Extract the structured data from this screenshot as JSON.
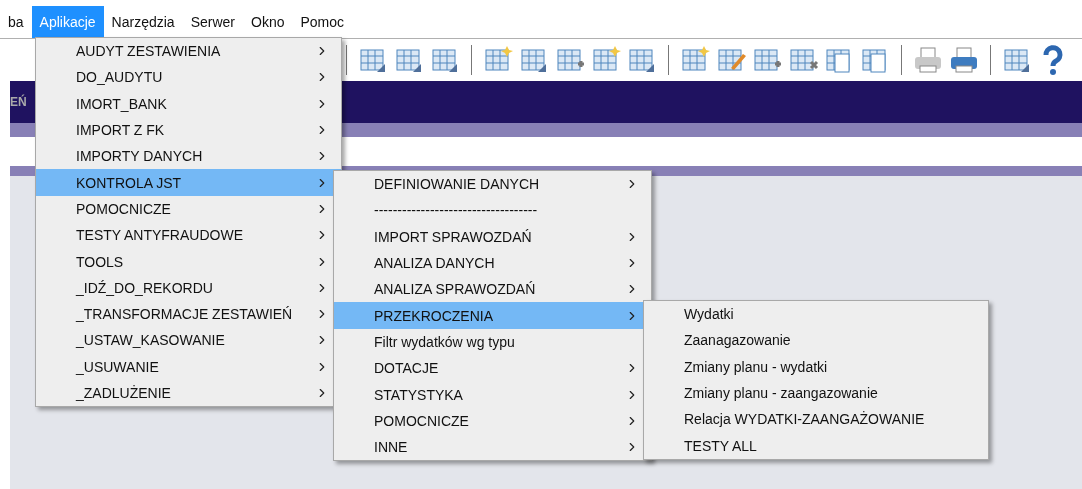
{
  "menubar": [
    {
      "label": "ba",
      "selected": false
    },
    {
      "label": "Aplikacje",
      "selected": true
    },
    {
      "label": "Narzędzia",
      "selected": false
    },
    {
      "label": "Serwer",
      "selected": false
    },
    {
      "label": "Okno",
      "selected": false
    },
    {
      "label": "Pomoc",
      "selected": false
    }
  ],
  "header_fragment": "EŃ",
  "menus": [
    {
      "items": [
        {
          "label": "AUDYT ZESTAWIENIA",
          "submenu": true,
          "selected": false
        },
        {
          "label": "DO_AUDYTU",
          "submenu": true,
          "selected": false
        },
        {
          "label": "IMORT_BANK",
          "submenu": true,
          "selected": false
        },
        {
          "label": "IMPORT Z FK",
          "submenu": true,
          "selected": false
        },
        {
          "label": "IMPORTY DANYCH",
          "submenu": true,
          "selected": false
        },
        {
          "label": "KONTROLA JST",
          "submenu": true,
          "selected": true
        },
        {
          "label": "POMOCNICZE",
          "submenu": true,
          "selected": false
        },
        {
          "label": "TESTY ANTYFRAUDOWE",
          "submenu": true,
          "selected": false
        },
        {
          "label": "TOOLS",
          "submenu": true,
          "selected": false
        },
        {
          "label": "_IDŹ_DO_REKORDU",
          "submenu": true,
          "selected": false
        },
        {
          "label": "_TRANSFORMACJE ZESTAWIEŃ",
          "submenu": true,
          "selected": false
        },
        {
          "label": "_USTAW_KASOWANIE",
          "submenu": true,
          "selected": false
        },
        {
          "label": "_USUWANIE",
          "submenu": true,
          "selected": false
        },
        {
          "label": "_ZADLUŻENIE",
          "submenu": true,
          "selected": false
        }
      ]
    },
    {
      "items": [
        {
          "label": "DEFINIOWANIE DANYCH",
          "submenu": true,
          "selected": false
        },
        {
          "label": "-----------------------------------",
          "submenu": false,
          "selected": false
        },
        {
          "label": "IMPORT SPRAWOZDAŃ",
          "submenu": true,
          "selected": false
        },
        {
          "label": "ANALIZA DANYCH",
          "submenu": true,
          "selected": false
        },
        {
          "label": "ANALIZA SPRAWOZDAŃ",
          "submenu": true,
          "selected": false
        },
        {
          "label": "PRZEKROCZENIA",
          "submenu": true,
          "selected": true
        },
        {
          "label": "Filtr wydatków wg typu",
          "submenu": false,
          "selected": false
        },
        {
          "label": "DOTACJE",
          "submenu": true,
          "selected": false
        },
        {
          "label": "STATYSTYKA",
          "submenu": true,
          "selected": false
        },
        {
          "label": "POMOCNICZE",
          "submenu": true,
          "selected": false
        },
        {
          "label": "INNE",
          "submenu": true,
          "selected": false
        }
      ]
    },
    {
      "items": [
        {
          "label": "Wydatki",
          "submenu": false,
          "selected": false
        },
        {
          "label": "Zaanagazowanie",
          "submenu": false,
          "selected": false
        },
        {
          "label": "Zmiany planu - wydatki",
          "submenu": false,
          "selected": false
        },
        {
          "label": "Zmiany planu - zaangazowanie",
          "submenu": false,
          "selected": false
        },
        {
          "label": "Relacja WYDATKI-ZAANGAŻOWANIE",
          "submenu": false,
          "selected": false
        },
        {
          "label": "TESTY ALL",
          "submenu": false,
          "selected": false
        }
      ]
    }
  ]
}
